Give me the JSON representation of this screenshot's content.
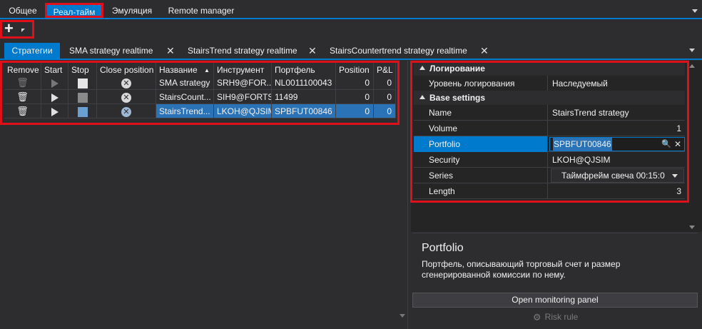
{
  "top_tabs": {
    "items": [
      {
        "label": "Общее"
      },
      {
        "label": "Реал-тайм"
      },
      {
        "label": "Эмуляция"
      },
      {
        "label": "Remote manager"
      }
    ]
  },
  "toolbar": {
    "add_symbol": "+"
  },
  "strategy_tabs": {
    "items": [
      {
        "label": "Стратегии"
      },
      {
        "label": "SMA strategy realtime"
      },
      {
        "label": "StairsTrend strategy realtime"
      },
      {
        "label": "StairsCountertrend strategy realtime"
      }
    ],
    "close_glyph": "✕"
  },
  "grid": {
    "columns": [
      "Remove",
      "Start",
      "Stop",
      "Close position",
      "Название",
      "Инструмент",
      "Портфель",
      "Position",
      "P&L"
    ],
    "sort_indicator": "▲",
    "rows": [
      {
        "name": "SMA strategy",
        "instrument": "SRH9@FOR...",
        "portfolio": "NL0011100043",
        "position": "0",
        "pnl": "0"
      },
      {
        "name": "StairsCount...",
        "instrument": "SIH9@FORTS",
        "portfolio": "11499",
        "position": "0",
        "pnl": "0"
      },
      {
        "name": "StairsTrend...",
        "instrument": "LKOH@QJSIM",
        "portfolio": "SPBFUT00846",
        "position": "0",
        "pnl": "0"
      }
    ],
    "selected_row": 2
  },
  "properties": {
    "categories": [
      {
        "label": "Логирование",
        "rows": [
          {
            "name": "Уровень логирования",
            "value": "Наследуемый"
          }
        ]
      },
      {
        "label": "Base settings",
        "rows": [
          {
            "name": "Name",
            "value": "StairsTrend strategy"
          },
          {
            "name": "Volume",
            "value": "1"
          },
          {
            "name": "Portfolio",
            "value": "SPBFUT00846"
          },
          {
            "name": "Security",
            "value": "LKOH@QJSIM"
          },
          {
            "name": "Series",
            "value": "Таймфрейм свеча 00:15:0"
          },
          {
            "name": "Length",
            "value": "3"
          }
        ]
      }
    ],
    "selected": "Portfolio"
  },
  "description": {
    "title": "Portfolio",
    "text": "Портфель, описывающий торговый счет и размер сгенерированной комиссии по нему."
  },
  "buttons": {
    "open_monitoring": "Open monitoring panel",
    "risk_rule": "Risk rule"
  },
  "colors": {
    "accent": "#007acc",
    "highlight_frame": "#e0101b",
    "selected_row": "#2b73b7",
    "background": "#2d2d30"
  }
}
